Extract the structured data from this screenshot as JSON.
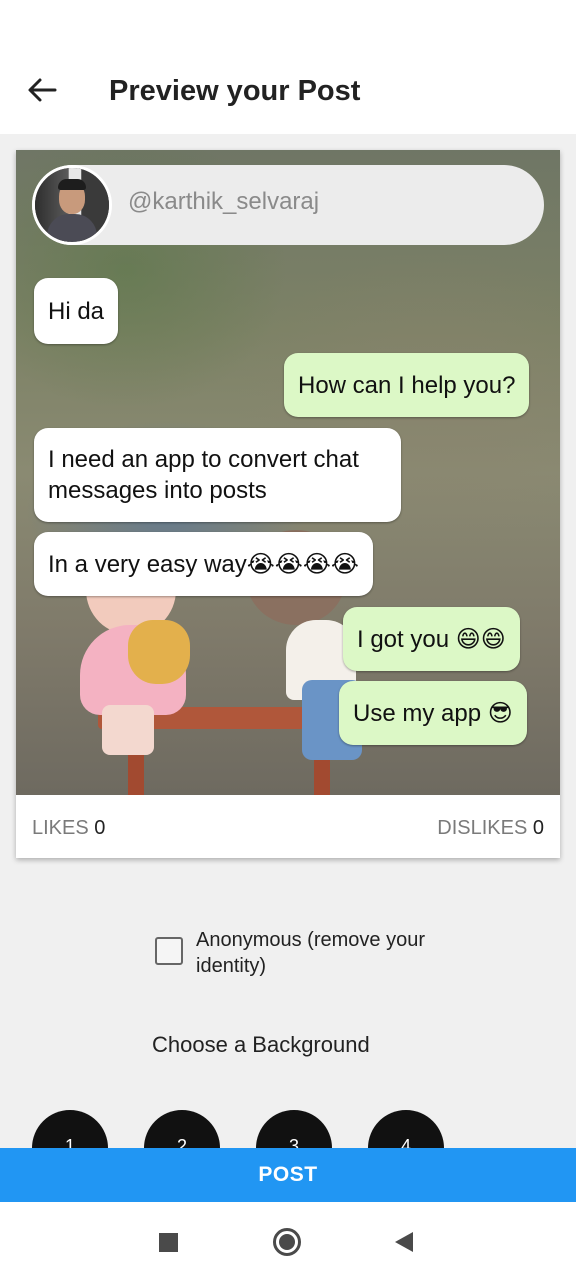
{
  "app_bar": {
    "title": "Preview your Post",
    "back_icon": "arrow-left-icon"
  },
  "post": {
    "username": "@karthik_selvaraj",
    "messages": [
      {
        "text": "Hi da",
        "type": "received"
      },
      {
        "text": "How can I help you?",
        "type": "sent"
      },
      {
        "text": "I need an app to convert chat\nmessages into posts",
        "type": "received"
      },
      {
        "text": "In a very easy way😭😭😭😭",
        "type": "received"
      },
      {
        "text": "I got you 😄😄",
        "type": "sent"
      },
      {
        "text": "Use my app 😎",
        "type": "sent"
      }
    ],
    "likes_label": "LIKES",
    "likes_count": "0",
    "dislikes_label": "DISLIKES",
    "dislikes_count": "0"
  },
  "options": {
    "anonymous_label": "Anonymous (remove your identity)",
    "anonymous_checked": false,
    "choose_background_label": "Choose a Background",
    "backgrounds": [
      "1",
      "2",
      "3",
      "4"
    ]
  },
  "actions": {
    "post_label": "POST"
  },
  "system_nav": {
    "recents_icon": "square-icon",
    "home_icon": "circle-icon",
    "back_icon": "triangle-back-icon"
  },
  "colors": {
    "accent": "#2196f3",
    "sent_bubble": "#dcf8c6",
    "received_bubble": "#ffffff"
  }
}
